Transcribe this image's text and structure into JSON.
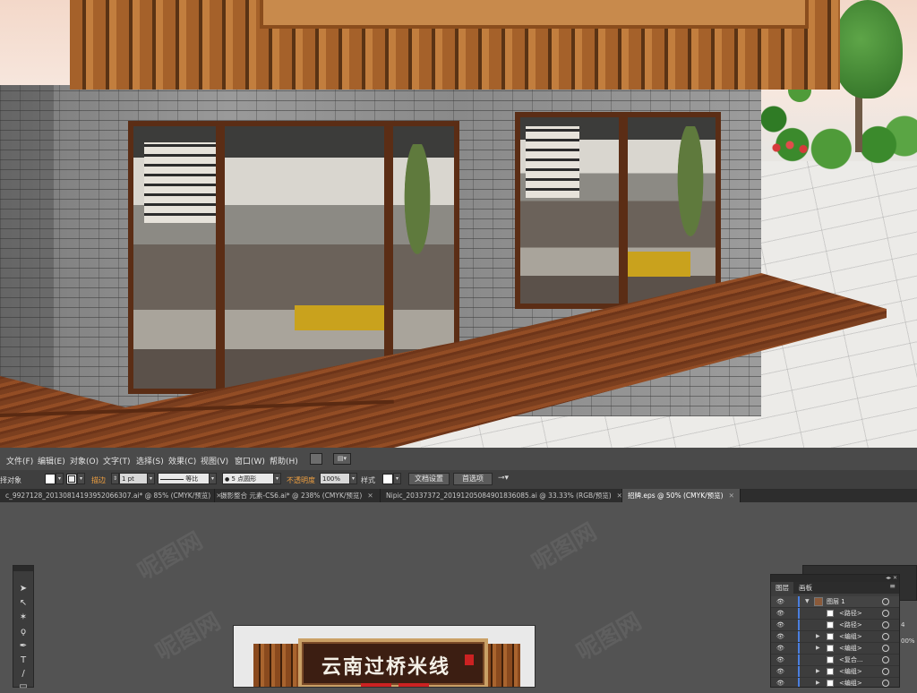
{
  "menu": [
    "文件(F)",
    "编辑(E)",
    "对象(O)",
    "文字(T)",
    "选择(S)",
    "效果(C)",
    "视图(V)",
    "窗口(W)",
    "帮助(H)"
  ],
  "control_bar": {
    "selection_label": "择对象",
    "stroke_label": "描边",
    "stroke_weight": "1 pt",
    "stroke_profile": "等比",
    "brush": "5 点圆形",
    "opacity_label": "不透明度",
    "opacity_value": "100%",
    "style_label": "样式",
    "doc_setup": "文档设置",
    "preferences": "首选项"
  },
  "doc_tabs": [
    {
      "label": "c_9927128_20130814193952066307.ai* @ 85% (CMYK/预览)",
      "active": false
    },
    {
      "label": "摄影整合 元素-CS6.ai* @ 238% (CMYK/预览)",
      "active": false
    },
    {
      "label": "Nipic_20337372_20191205084901836085.ai @ 33.33% (RGB/预览)",
      "active": false
    },
    {
      "label": "招牌.eps @ 50% (CMYK/预览)",
      "active": true
    }
  ],
  "artboard": {
    "sign_text": "云南过桥米线"
  },
  "layers_panel": {
    "tabs": [
      "图层",
      "画板"
    ],
    "rows": [
      {
        "name": "图层 1",
        "expandable": true,
        "top": true
      },
      {
        "name": "<路径>",
        "expandable": false
      },
      {
        "name": "<路径>",
        "expandable": false
      },
      {
        "name": "<编组>",
        "expandable": true
      },
      {
        "name": "<编组>",
        "expandable": true
      },
      {
        "name": "<复合...",
        "expandable": false
      },
      {
        "name": "<编组>",
        "expandable": true
      },
      {
        "name": "<编组>",
        "expandable": true
      }
    ]
  },
  "side_fragments": [
    "4",
    "00%"
  ],
  "watermark": "呢图网"
}
